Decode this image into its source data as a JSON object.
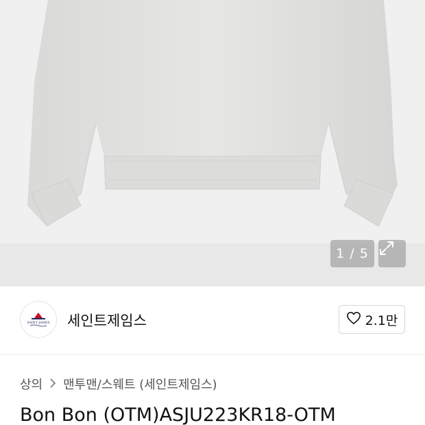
{
  "gallery": {
    "counter": "1 / 5",
    "expand_icon": "expand-icon",
    "background": "#e9e9e9"
  },
  "brand": {
    "name": "세인트제임스",
    "logo_text": "SAINT JAMES",
    "like_count": "2.1만",
    "like_icon": "heart-outline-icon"
  },
  "breadcrumb": {
    "items": [
      "상의",
      "맨투맨/스웨트 (세인트제임스)"
    ],
    "separator_icon": "chevron-right-icon"
  },
  "product": {
    "title": "Bon Bon (OTM)ASJU223KR18-OTM"
  }
}
